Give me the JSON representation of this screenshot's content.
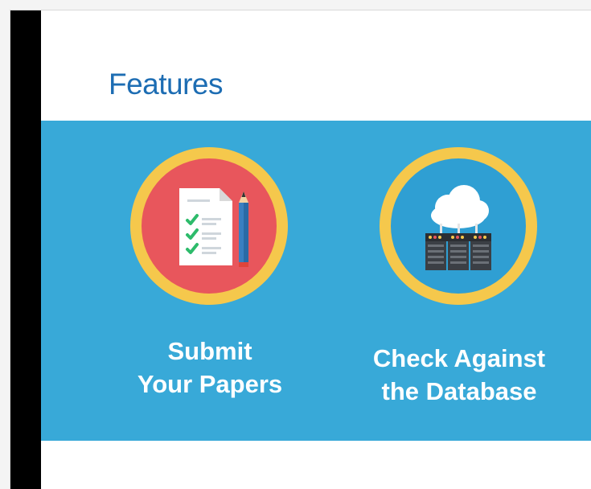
{
  "slide": {
    "title": "Features"
  },
  "features": [
    {
      "line1": "Submit",
      "line2": "Your Papers",
      "icon": "document-checklist-pencil-icon"
    },
    {
      "line1": "Check Against",
      "line2": "the Database",
      "icon": "cloud-server-database-icon"
    }
  ],
  "colors": {
    "title": "#1d6db3",
    "band": "#38a9d8",
    "ring": "#f5c84c",
    "submit_fill": "#e8565c",
    "check_fill": "#2f9fd3",
    "label": "#ffffff"
  }
}
